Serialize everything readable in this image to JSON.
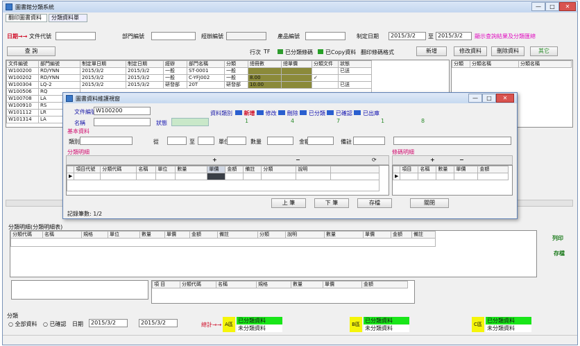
{
  "window": {
    "title": "圖書館分類系統",
    "controls": [
      "—",
      "□",
      "✕"
    ]
  },
  "tabs": [
    "翻印圖書資料",
    "分類資料單"
  ],
  "filter": {
    "date_label": "日期→→",
    "field1_label": "文件代號",
    "field2_label": "部門編號",
    "field3_label": "經辦編號",
    "field4_label": "產品編號",
    "date_from_label": "制定日期",
    "date_from": "2015/3/2",
    "date_to_label": "至",
    "date_to": "2015/3/2",
    "link": "顯示查詢結果及分類匯總"
  },
  "toolbar": {
    "search": "查 詢",
    "row_label": "行次",
    "count_label": "TF",
    "legend_1": "已分類條碼",
    "legend_2": "已Copy資料",
    "legend_3": "翻印條碼格式",
    "btn_new": "新增",
    "btn_modify": "修改資料",
    "btn_del": "刪除資料",
    "btn_other": "其它"
  },
  "main_table": {
    "headers": [
      "文件編號",
      "部門編號",
      "制定單日期",
      "制定日期",
      "經辦",
      "部門名稱",
      "分類",
      "總冊數",
      "總單價",
      "分類文件",
      "狀態"
    ],
    "rows": [
      [
        "W100200",
        "RD/YNN",
        "2015/3/2",
        "2015/3/2",
        "一般",
        "ST-0001",
        "一般",
        "",
        "",
        "",
        "已送"
      ],
      [
        "W100202",
        "RD/YNN",
        "2015/3/2",
        "2015/3/2",
        "一般",
        "C-YFJ002",
        "一般",
        "8.00",
        "",
        "✓",
        ""
      ],
      [
        "W100304",
        "LQ-2",
        "2015/3/2",
        "2015/3/2",
        "研發部",
        "20T",
        "研發部",
        "10.00",
        "",
        "",
        "已送"
      ],
      [
        "W100506",
        "RQ",
        "",
        "",
        "",
        "",
        "",
        "",
        "",
        "",
        ""
      ],
      [
        "W100708",
        "LA",
        "",
        "",
        "",
        "",
        "",
        "",
        "",
        "",
        ""
      ],
      [
        "W100910",
        "RS",
        "",
        "",
        "",
        "",
        "",
        "",
        "",
        "",
        ""
      ],
      [
        "W101112",
        "LR",
        "",
        "",
        "",
        "",
        "",
        "",
        "",
        "",
        ""
      ],
      [
        "W101314",
        "LA",
        "",
        "",
        "",
        "",
        "",
        "",
        "",
        "",
        ""
      ]
    ],
    "right_headers": [
      "分類",
      "分類名稱",
      "分類名稱"
    ]
  },
  "dialog": {
    "title": "圖書資料維護視窗",
    "doc_label": "文件編號",
    "doc_value": "W100200",
    "name_label": "名稱",
    "status_label": "狀態",
    "legend": [
      "新增",
      "修改",
      "刪除",
      "已分類",
      "已確認",
      "已出庫"
    ],
    "legend_title": "資料類別",
    "counts": [
      "1",
      "4",
      "7",
      "1",
      "8"
    ],
    "section1": "基本資料",
    "f_type": "類別",
    "f_from": "從",
    "f_to": "至",
    "f_unit": "單位",
    "f_qty": "數量",
    "f_amt": "金額",
    "f_note": "備註",
    "section2": "分類明細",
    "section3": "條碼明細",
    "grid_headers": [
      "項目代號",
      "分類代碼",
      "名稱",
      "單位",
      "數量",
      "單價",
      "金額",
      "備註",
      "分類",
      "說明"
    ],
    "grid2_headers": [
      "項目",
      "名稱",
      "數量",
      "單價",
      "金額"
    ],
    "btn_prev": "上 筆",
    "btn_next": "下 筆",
    "btn_save": "存檔",
    "btn_close": "關閉",
    "footer": "記錄筆數: 1/2"
  },
  "detail": {
    "title": "分類明細(分類明細表)",
    "headers": [
      "分類代碼",
      "名稱",
      "規格",
      "單位",
      "數量",
      "單價",
      "金額",
      "備註",
      "分類",
      "說明",
      "數量",
      "單價",
      "金額",
      "備註"
    ],
    "btn_print": "列印",
    "btn_save": "存檔",
    "sub_headers": [
      "項 目",
      "分類代碼",
      "名稱",
      "規格",
      "數量",
      "單價",
      "金額"
    ]
  },
  "bottom": {
    "label1": "分類",
    "radio1": "全部資料",
    "radio2": "已確認",
    "date_label": "日期",
    "date_from": "2015/3/2",
    "date_to": "2015/3/2",
    "count_label": "總計→→",
    "box1_tag": "A區",
    "box1_line1": "已分類資料",
    "box1_line2": "未分類資料",
    "box2_tag": "B區",
    "box2_line1": "已分類資料",
    "box2_line2": "未分類資料",
    "box3_tag": "C區",
    "box3_line1": "已分類資料",
    "box3_line2": "未分類資料"
  }
}
